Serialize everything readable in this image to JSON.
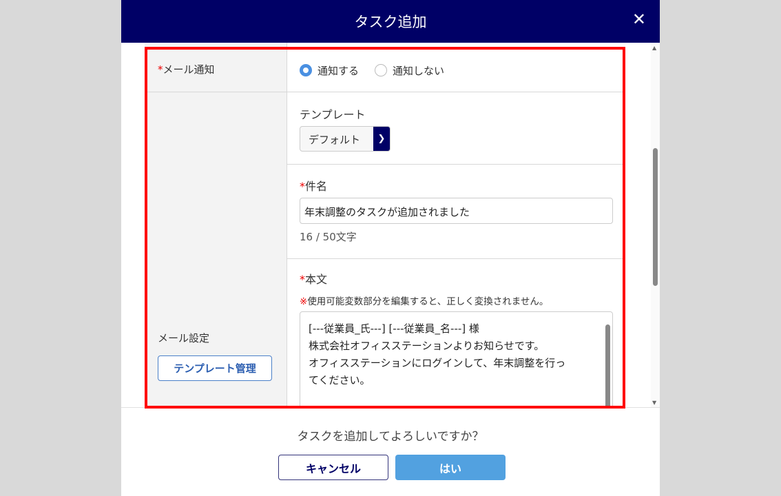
{
  "dialog": {
    "title": "タスク追加",
    "close_icon": "close-icon"
  },
  "mail_notify": {
    "label": "メール通知",
    "required_mark": "*",
    "options": [
      {
        "label": "通知する",
        "selected": true
      },
      {
        "label": "通知しない",
        "selected": false
      }
    ]
  },
  "mail_settings": {
    "label": "メール設定",
    "template_manage_button": "テンプレート管理"
  },
  "template": {
    "label": "テンプレート",
    "selected": "デフォルト"
  },
  "subject": {
    "label": "件名",
    "required_mark": "*",
    "value": "年末調整のタスクが追加されました",
    "counter": "16 / 50文字"
  },
  "body": {
    "label": "本文",
    "required_mark": "*",
    "warning_mark": "※",
    "warning": "使用可能変数部分を編集すると、正しく変換されません。",
    "value": "[---従業員_氏---] [---従業員_名---] 様\n株式会社オフィスステーションよりお知らせです。\nオフィスステーションにログインして、年末調整を行っ\nてください。"
  },
  "footer": {
    "confirm": "タスクを追加してよろしいですか？",
    "cancel": "キャンセル",
    "yes": "はい"
  }
}
